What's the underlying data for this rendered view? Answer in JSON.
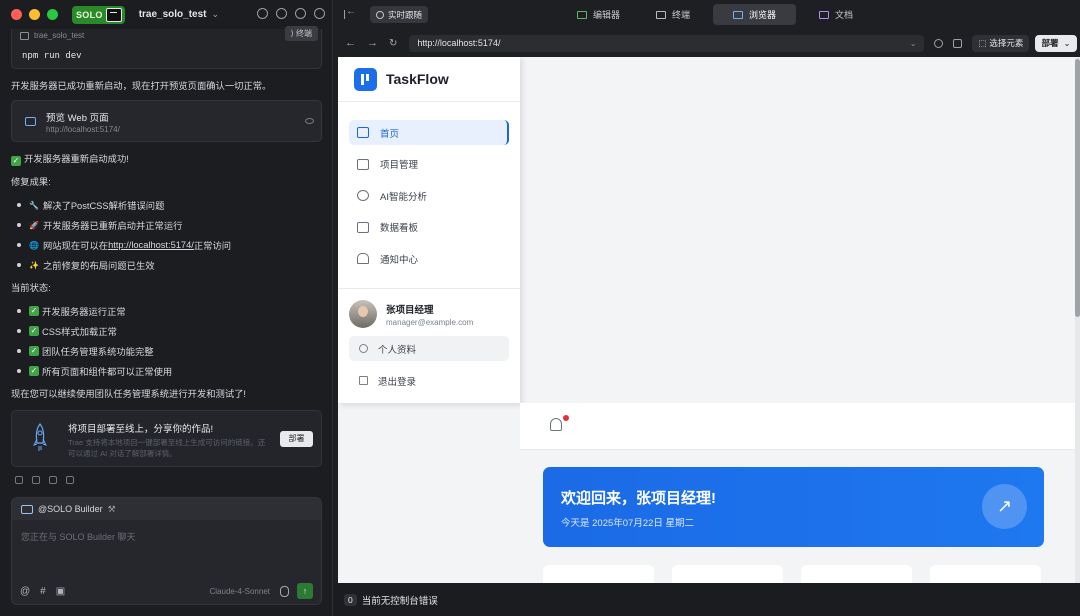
{
  "left": {
    "solo_label": "SOLO",
    "project": "trae_solo_test",
    "code_block": {
      "file": "trae_solo_test",
      "terminal_label": "终端",
      "code": "npm run dev"
    },
    "msg1": "开发服务器已成功重新启动，现在打开预览页面确认一切正常。",
    "preview": {
      "title": "预览 Web 页面",
      "url": "http://localhost:5174/"
    },
    "success": "开发服务器重新启动成功!",
    "fix_head": "修复成果:",
    "fixes": [
      {
        "emoji": "🔧",
        "text": "解决了PostCSS解析错误问题"
      },
      {
        "emoji": "🚀",
        "text": "开发服务器已重新启动并正常运行"
      },
      {
        "emoji": "🌐",
        "text_pre": "网站现在可以在 ",
        "link": "http://localhost:5174/",
        "text_post": " 正常访问"
      },
      {
        "emoji": "✨",
        "text": "之前修复的布局问题已生效"
      }
    ],
    "status_head": "当前状态:",
    "statuses": [
      "开发服务器运行正常",
      "CSS样式加载正常",
      "团队任务管理系统功能完整",
      "所有页面和组件都可以正常使用"
    ],
    "closing": "现在您可以继续使用团队任务管理系统进行开发和测试了!",
    "deploy_card": {
      "title": "将项目部署至线上，分享你的作品!",
      "desc": "Trae 支持将本地项目一键部署至线上生成可访问的链接。还可以通过 AI 对话了解部署详情。",
      "button": "部署"
    },
    "composer": {
      "agent": "@SOLO Builder",
      "placeholder": "您正在与 SOLO Builder 聊天",
      "model": "Claude-4-Sonnet"
    }
  },
  "right": {
    "follow": "实时跟随",
    "tabs": [
      {
        "label": "编辑器",
        "active": false
      },
      {
        "label": "终端",
        "active": false
      },
      {
        "label": "浏览器",
        "active": true
      },
      {
        "label": "文档",
        "active": false
      }
    ],
    "url": "http://localhost:5174/",
    "select_element": "选择元素",
    "deploy": "部署",
    "app": {
      "brand": "TaskFlow",
      "menu": [
        "首页",
        "项目管理",
        "AI智能分析",
        "数据看板",
        "通知中心"
      ],
      "user_name": "张项目经理",
      "user_email": "manager@example.com",
      "profile": "个人资料",
      "logout": "退出登录",
      "welcome_title": "欢迎回来，张项目经理!",
      "welcome_date": "今天是 2025年07月22日 星期二"
    },
    "console": {
      "count": "0",
      "text": "当前无控制台错误"
    }
  }
}
